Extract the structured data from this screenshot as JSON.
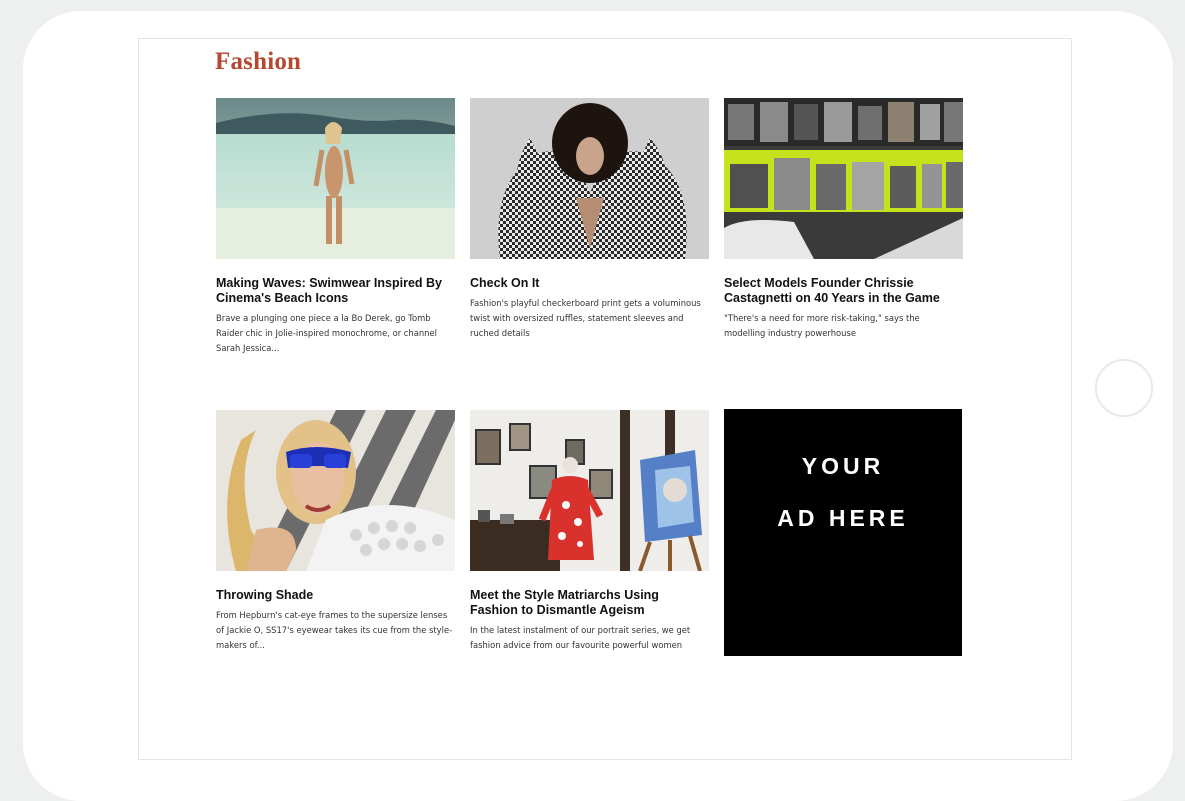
{
  "section": {
    "title": "Fashion"
  },
  "articles": [
    {
      "image": "swimwear-beach-photo",
      "headline": "Making Waves: Swimwear Inspired By Cinema's Beach Icons",
      "summary": "Brave a plunging one piece a la Bo Derek, go Tomb Raider chic in Jolie-inspired monochrome, or channel Sarah Jessica..."
    },
    {
      "image": "checkerboard-fashion-photo",
      "headline": "Check On It",
      "summary": "Fashion's playful checkerboard print gets a voluminous twist with oversized ruffles, statement sleeves and ruched details"
    },
    {
      "image": "model-agency-wall-photo",
      "headline": "Select Models Founder Chrissie Castagnetti on 40 Years in the Game",
      "summary": "\"There's a need for more risk-taking,\" says the modelling industry powerhouse"
    },
    {
      "image": "cat-eye-sunglasses-photo",
      "headline": "Throwing Shade",
      "summary": "From Hepburn's cat-eye frames to the supersize lenses of Jackie O, SS17's eyewear takes its cue from the style-makers of..."
    },
    {
      "image": "style-matriarch-portrait-photo",
      "headline": "Meet the Style Matriarchs Using Fashion to Dismantle Ageism",
      "summary": "In the latest instalment of our portrait series, we get fashion advice from our favourite powerful women"
    }
  ],
  "ad": {
    "line1": "YOUR",
    "line2": "AD HERE"
  },
  "colors": {
    "accent": "#b5482f",
    "page_background": "#eef0ef",
    "ad_background": "#000000"
  }
}
